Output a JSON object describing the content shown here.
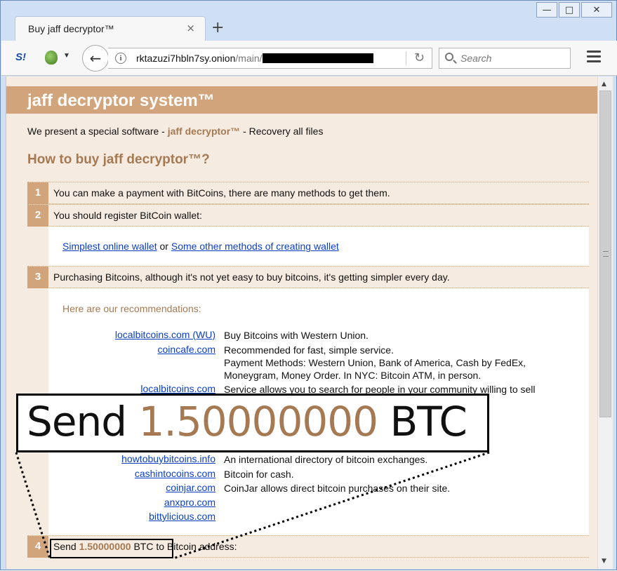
{
  "window": {
    "minimize": "—",
    "maximize": "□",
    "close": "✕"
  },
  "tab": {
    "title": "Buy jaff decryptor™",
    "close": "×",
    "new_tab": "+"
  },
  "toolbar": {
    "logo": "S!",
    "back": "←",
    "url_host": "rktazuzi7hbln7sy.onion",
    "url_path": "/main/",
    "reload": "↻",
    "search_placeholder": "Search",
    "icons": [
      "addon-logo-icon",
      "onion-icon",
      "back-arrow-icon",
      "info-icon",
      "reload-icon",
      "search-icon",
      "hamburger-menu-icon"
    ]
  },
  "page": {
    "title": "jaff decryptor system™",
    "intro_prefix": "We present a special software - ",
    "intro_product": "jaff decryptor™",
    "intro_suffix": " - Recovery all files",
    "howto_heading": "How to buy jaff decryptor™?",
    "steps": [
      {
        "num": "1",
        "text": "You can make a payment with BitCoins, there are many methods to get them."
      },
      {
        "num": "2",
        "text": "You should register BitCoin wallet:"
      },
      {
        "num": "3",
        "text": "Purchasing Bitcoins, although it's not yet easy to buy bitcoins, it's getting simpler every day."
      },
      {
        "num": "4",
        "text_prefix": "Send ",
        "amount": "1.50000000",
        "currency": " BTC",
        "text_suffix": " to Bitcoin address:"
      }
    ],
    "wallet_links": {
      "link1": "Simplest online wallet",
      "or": " or ",
      "link2": "Some other methods of creating wallet"
    },
    "recs_title": "Here are our recommendations:",
    "recommendations": [
      {
        "link": "localbitcoins.com (WU)",
        "desc": "Buy Bitcoins with Western Union."
      },
      {
        "link": "coincafe.com",
        "desc": "Recommended for fast, simple service."
      },
      {
        "link": "",
        "desc": "Payment Methods: Western Union, Bank of America, Cash by FedEx, Moneygram, Money Order. In NYC: Bitcoin ATM, in person."
      },
      {
        "link": "localbitcoins.com",
        "desc": "Service allows you to search for people in your community willing to sell"
      },
      {
        "link": "howtobuybitcoins.info",
        "desc": "An international directory of bitcoin exchanges."
      },
      {
        "link": "cashintocoins.com",
        "desc": "Bitcoin for cash."
      },
      {
        "link": "coinjar.com",
        "desc": "CoinJar allows direct bitcoin purchases on their site."
      },
      {
        "link": "anxpro.com",
        "desc": ""
      },
      {
        "link": "bittylicious.com",
        "desc": ""
      }
    ]
  },
  "zoom_callout": {
    "prefix": "Send ",
    "amount": "1.50000000",
    "currency": " BTC"
  },
  "colors": {
    "accent": "#d2a47c",
    "accent_text": "#a57a53",
    "page_bg": "#f5ebe0",
    "link": "#0b3fc4"
  }
}
